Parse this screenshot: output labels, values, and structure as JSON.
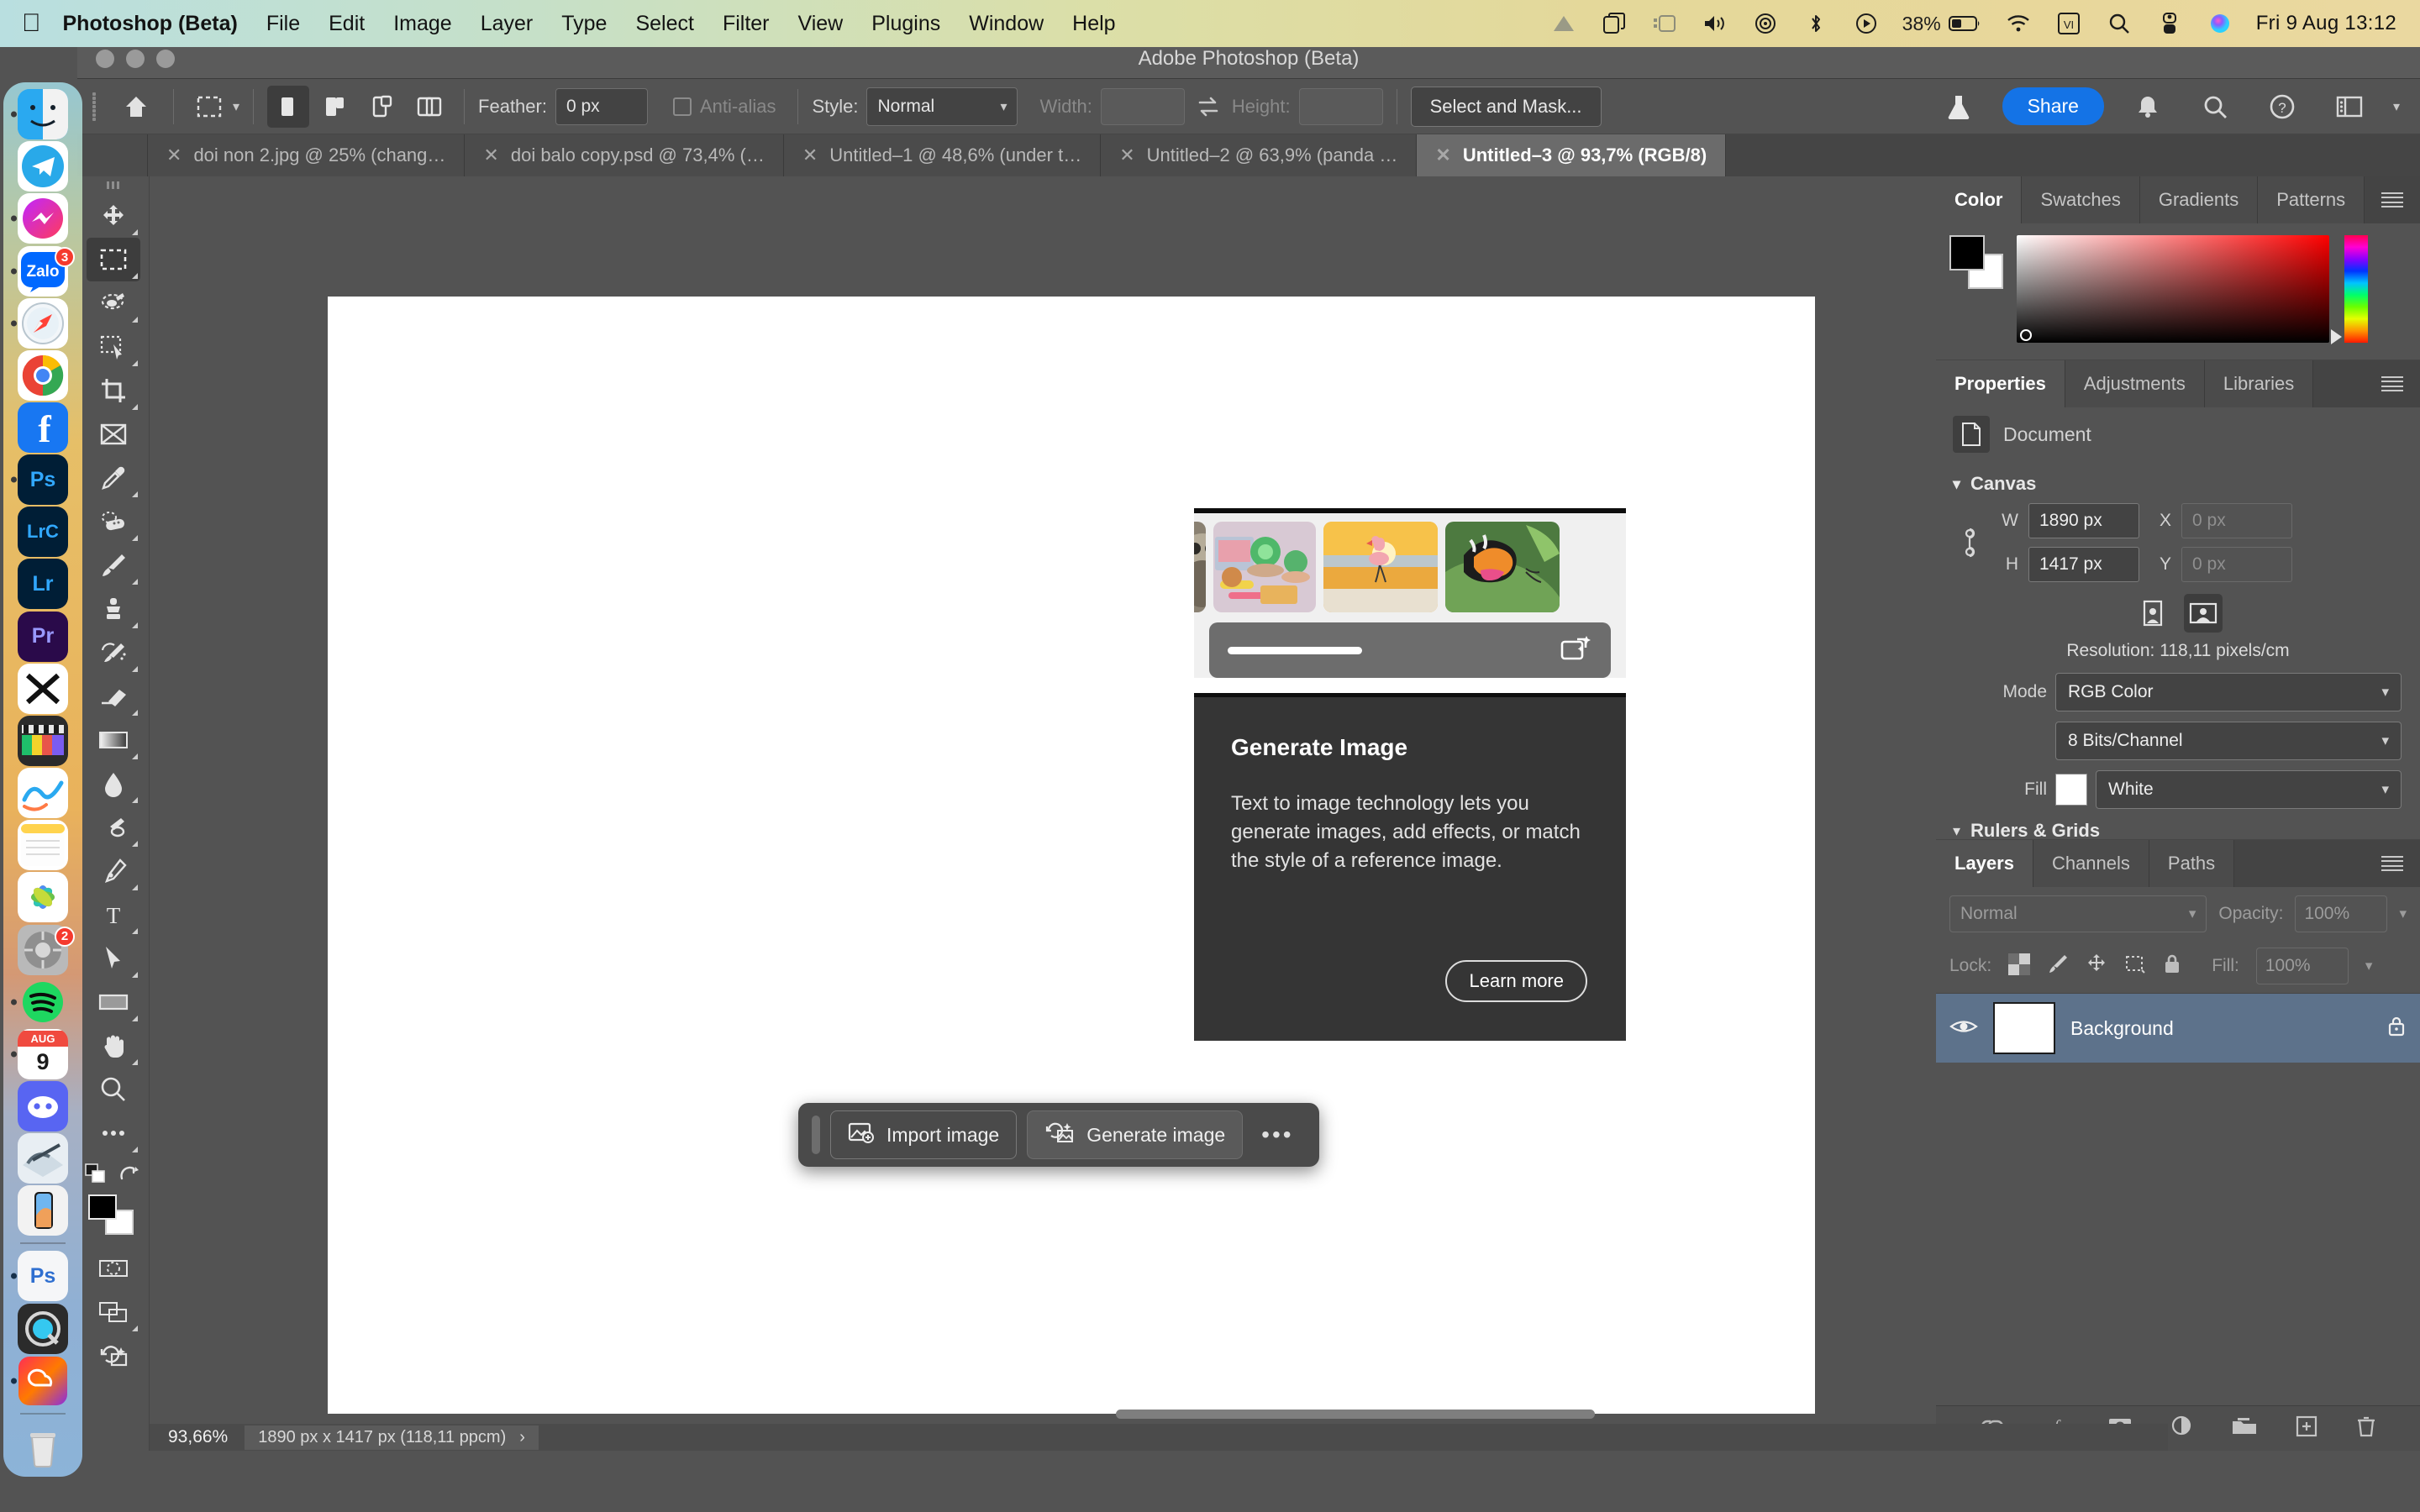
{
  "menubar": {
    "apple_icon": "apple-logo-icon",
    "app_name": "Photoshop (Beta)",
    "items": [
      "File",
      "Edit",
      "Image",
      "Layer",
      "Type",
      "Select",
      "Filter",
      "View",
      "Plugins",
      "Window",
      "Help"
    ],
    "status_icons": [
      "adobe-cc-icon",
      "screen-mirroring-icon",
      "stage-manager-icon",
      "volume-icon",
      "airdrop-icon",
      "bluetooth-icon",
      "now-playing-icon"
    ],
    "battery_percent": "38%",
    "right_icons": [
      "wifi-icon",
      "input-source-vi-icon",
      "spotlight-search-icon",
      "control-center-icon",
      "siri-icon"
    ],
    "input_source": "VI",
    "clock": "Fri 9 Aug  13:12"
  },
  "dock": {
    "items": [
      {
        "name": "finder",
        "label": "Finder",
        "running": true,
        "badge": null
      },
      {
        "name": "telegram",
        "label": "Telegram",
        "running": false,
        "badge": null
      },
      {
        "name": "messenger",
        "label": "Messenger",
        "running": true,
        "badge": null
      },
      {
        "name": "zalo",
        "label": "Zalo",
        "running": true,
        "badge": "3"
      },
      {
        "name": "safari",
        "label": "Safari",
        "running": true,
        "badge": null
      },
      {
        "name": "chrome",
        "label": "Google Chrome",
        "running": false,
        "badge": null
      },
      {
        "name": "facebook",
        "label": "Facebook",
        "running": false,
        "badge": null
      },
      {
        "name": "photoshop-ps",
        "label": "Ps",
        "running": true,
        "badge": null
      },
      {
        "name": "lightroom-classic",
        "label": "LrC",
        "running": false,
        "badge": null
      },
      {
        "name": "lightroom",
        "label": "Lr",
        "running": false,
        "badge": null
      },
      {
        "name": "premiere-pro",
        "label": "Pr",
        "running": false,
        "badge": null
      },
      {
        "name": "capcut",
        "label": "CapCut",
        "running": false,
        "badge": null
      },
      {
        "name": "final-cut-pro",
        "label": "Final Cut Pro",
        "running": false,
        "badge": null
      },
      {
        "name": "freeform",
        "label": "Freeform",
        "running": false,
        "badge": null
      },
      {
        "name": "notes",
        "label": "Notes",
        "running": false,
        "badge": null
      },
      {
        "name": "photos",
        "label": "Photos",
        "running": false,
        "badge": null
      },
      {
        "name": "system-settings",
        "label": "System Settings",
        "running": false,
        "badge": "2"
      },
      {
        "name": "spotify",
        "label": "Spotify",
        "running": true,
        "badge": null
      },
      {
        "name": "calendar",
        "label": "Calendar",
        "running": true,
        "badge": null,
        "month": "AUG",
        "day": "9"
      },
      {
        "name": "discord",
        "label": "Discord",
        "running": false,
        "badge": null
      },
      {
        "name": "xcode-like",
        "label": "Utility",
        "running": false,
        "badge": null
      },
      {
        "name": "iphone-mirroring",
        "label": "iPhone Mirroring",
        "running": false,
        "badge": null
      },
      {
        "name": "photoshop-beta",
        "label": "Ps",
        "running": true,
        "badge": null
      },
      {
        "name": "quicktime",
        "label": "QuickTime Player",
        "running": false,
        "badge": null
      },
      {
        "name": "creative-cloud",
        "label": "Creative Cloud",
        "running": true,
        "badge": null
      },
      {
        "name": "trash",
        "label": "Trash",
        "running": false,
        "badge": null
      }
    ]
  },
  "window": {
    "title": "Adobe Photoshop (Beta)"
  },
  "options_bar": {
    "home_icon": "home-icon",
    "tool_preset_icon": "rectangular-marquee-icon",
    "selection_modes": [
      "new-selection",
      "add-to-selection",
      "subtract-from-selection",
      "intersect-with-selection"
    ],
    "feather_label": "Feather:",
    "feather_value": "0 px",
    "antialias_label": "Anti-alias",
    "style_label": "Style:",
    "style_value": "Normal",
    "width_label": "Width:",
    "width_value": "",
    "swap_icon": "swap-width-height-icon",
    "height_label": "Height:",
    "height_value": "",
    "select_and_mask": "Select and Mask...",
    "beaker_icon": "beaker-icon",
    "share_label": "Share",
    "right_icons": [
      "bell-icon",
      "search-icon",
      "help-icon",
      "workspace-icon",
      "chevron-down-icon"
    ]
  },
  "tabs": [
    {
      "label": "doi non 2.jpg @ 25% (chang…",
      "active": false
    },
    {
      "label": "doi balo copy.psd @ 73,4% (…",
      "active": false
    },
    {
      "label": "Untitled–1 @ 48,6% (under t…",
      "active": false
    },
    {
      "label": "Untitled–2 @ 63,9% (panda …",
      "active": false
    },
    {
      "label": "Untitled–3 @ 93,7% (RGB/8)",
      "active": true
    }
  ],
  "tools": [
    {
      "name": "move-tool",
      "icon": "move-icon",
      "selected": false,
      "has_flyout": true
    },
    {
      "name": "rectangular-marquee-tool",
      "icon": "marquee-icon",
      "selected": true,
      "has_flyout": true
    },
    {
      "name": "lasso-tool",
      "icon": "lasso-icon",
      "selected": false,
      "has_flyout": true
    },
    {
      "name": "object-selection-tool",
      "icon": "object-select-icon",
      "selected": false,
      "has_flyout": true
    },
    {
      "name": "crop-tool",
      "icon": "crop-icon",
      "selected": false,
      "has_flyout": true
    },
    {
      "name": "frame-tool",
      "icon": "frame-icon",
      "selected": false,
      "has_flyout": false
    },
    {
      "name": "eyedropper-tool",
      "icon": "eyedropper-icon",
      "selected": false,
      "has_flyout": true
    },
    {
      "name": "healing-brush-tool",
      "icon": "healing-brush-icon",
      "selected": false,
      "has_flyout": true
    },
    {
      "name": "brush-tool",
      "icon": "brush-icon",
      "selected": false,
      "has_flyout": true
    },
    {
      "name": "clone-stamp-tool",
      "icon": "clone-stamp-icon",
      "selected": false,
      "has_flyout": true
    },
    {
      "name": "history-brush-tool",
      "icon": "history-brush-icon",
      "selected": false,
      "has_flyout": true
    },
    {
      "name": "eraser-tool",
      "icon": "eraser-icon",
      "selected": false,
      "has_flyout": true
    },
    {
      "name": "gradient-tool",
      "icon": "gradient-icon",
      "selected": false,
      "has_flyout": true
    },
    {
      "name": "blur-tool",
      "icon": "blur-drop-icon",
      "selected": false,
      "has_flyout": true
    },
    {
      "name": "dodge-tool",
      "icon": "dodge-icon",
      "selected": false,
      "has_flyout": true
    },
    {
      "name": "pen-tool",
      "icon": "pen-icon",
      "selected": false,
      "has_flyout": true
    },
    {
      "name": "type-tool",
      "icon": "type-t-icon",
      "selected": false,
      "has_flyout": true
    },
    {
      "name": "path-selection-tool",
      "icon": "path-arrow-icon",
      "selected": false,
      "has_flyout": true
    },
    {
      "name": "rectangle-tool",
      "icon": "rectangle-icon",
      "selected": false,
      "has_flyout": true
    },
    {
      "name": "hand-tool",
      "icon": "hand-icon",
      "selected": false,
      "has_flyout": true
    },
    {
      "name": "zoom-tool",
      "icon": "magnifier-icon",
      "selected": false,
      "has_flyout": false
    },
    {
      "name": "edit-toolbar",
      "icon": "ellipsis-icon",
      "selected": false,
      "has_flyout": true
    }
  ],
  "tool_footer": {
    "default_colors_icon": "default-colors-icon",
    "swap_colors_icon": "swap-colors-icon",
    "foreground_color": "#000000",
    "background_color": "#ffffff",
    "quick_mask_icon": "quick-mask-icon",
    "screen_mode_icon": "screen-mode-icon",
    "generate_icon": "generate-image-icon"
  },
  "rail": {
    "collapse_icon": "collapse-panels-icon",
    "icons": [
      "history-icon",
      "comments-icon"
    ]
  },
  "color_panel": {
    "tabs": [
      {
        "label": "Color",
        "active": true
      },
      {
        "label": "Swatches",
        "active": false
      },
      {
        "label": "Gradients",
        "active": false
      },
      {
        "label": "Patterns",
        "active": false
      }
    ],
    "menu_icon": "panel-menu-icon",
    "foreground": "#000000",
    "background": "#ffffff"
  },
  "properties_panel": {
    "tabs": [
      {
        "label": "Properties",
        "active": true
      },
      {
        "label": "Adjustments",
        "active": false
      },
      {
        "label": "Libraries",
        "active": false
      }
    ],
    "menu_icon": "panel-menu-icon",
    "doc_icon": "document-icon",
    "doc_label": "Document",
    "section_canvas": "Canvas",
    "link_icon": "link-dimensions-icon",
    "w_label": "W",
    "w_value": "1890 px",
    "h_label": "H",
    "h_value": "1417 px",
    "x_label": "X",
    "x_value": "0 px",
    "y_label": "Y",
    "y_value": "0 px",
    "orientation_portrait_icon": "portrait-orientation-icon",
    "orientation_landscape_icon": "landscape-orientation-icon",
    "resolution": "Resolution: 118,11 pixels/cm",
    "mode_label": "Mode",
    "mode_value": "RGB Color",
    "depth_value": "8 Bits/Channel",
    "fill_label": "Fill",
    "fill_color": "#ffffff",
    "fill_value": "White",
    "next_section": "Rulers & Grids"
  },
  "layers_panel": {
    "tabs": [
      {
        "label": "Layers",
        "active": true
      },
      {
        "label": "Channels",
        "active": false
      },
      {
        "label": "Paths",
        "active": false
      }
    ],
    "menu_icon": "panel-menu-icon",
    "blend_mode": "Normal",
    "opacity_label": "Opacity:",
    "opacity_value": "100%",
    "lock_label": "Lock:",
    "lock_icons": [
      "lock-transparent-pixels-icon",
      "lock-image-pixels-icon",
      "lock-position-icon",
      "lock-artboard-icon",
      "lock-all-icon"
    ],
    "fill_label": "Fill:",
    "fill_value": "100%",
    "layers": [
      {
        "name": "Background",
        "visible": true,
        "locked": true,
        "selected": true
      }
    ],
    "bottom_icons": [
      "link-layers-icon",
      "layer-style-fx-icon",
      "layer-mask-icon",
      "adjustment-layer-icon",
      "new-group-icon",
      "new-layer-icon",
      "delete-layer-icon"
    ]
  },
  "generate_popup": {
    "thumbnails": [
      "owl-thumbnail",
      "desk-plants-thumbnail",
      "flamingo-sunset-thumbnail",
      "butterfly-thumbnail"
    ],
    "prompt_placeholder": "",
    "generate_icon": "generate-sparkle-icon",
    "title": "Generate Image",
    "body": "Text to image technology lets you generate images, add effects, or match the style of a reference image.",
    "learn_more": "Learn more"
  },
  "contextual_taskbar": {
    "import_label": "Import image",
    "import_icon": "import-image-icon",
    "generate_label": "Generate image",
    "generate_icon": "generate-image-icon",
    "more_label": "•••"
  },
  "status_bar": {
    "zoom": "93,66%",
    "doc_info": "1890 px x 1417 px (118,11 ppcm)",
    "chevron": "›"
  }
}
